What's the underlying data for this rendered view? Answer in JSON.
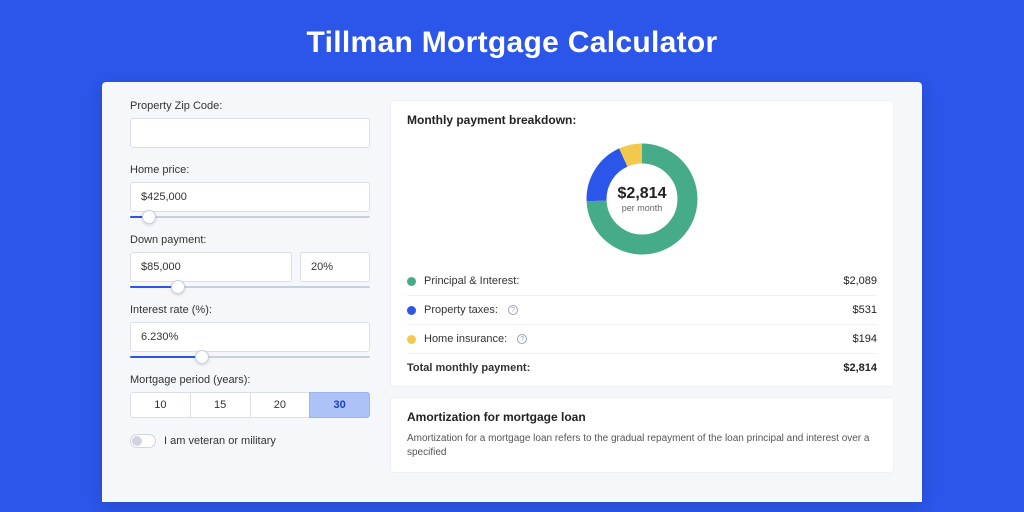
{
  "title": "Tillman Mortgage Calculator",
  "form": {
    "zip_label": "Property Zip Code:",
    "zip_value": "",
    "home_price_label": "Home price:",
    "home_price_value": "$425,000",
    "home_price_slider_pct": 8,
    "down_payment_label": "Down payment:",
    "down_payment_value": "$85,000",
    "down_payment_pct_value": "20%",
    "down_payment_slider_pct": 20,
    "interest_label": "Interest rate (%):",
    "interest_value": "6.230%",
    "interest_slider_pct": 30,
    "period_label": "Mortgage period (years):",
    "period_options": [
      "10",
      "15",
      "20",
      "30"
    ],
    "period_selected": "30",
    "veteran_label": "I am veteran or military"
  },
  "breakdown": {
    "title": "Monthly payment breakdown:",
    "total_value": "$2,814",
    "total_sub": "per month",
    "rows": [
      {
        "label": "Principal & Interest:",
        "value": "$2,089",
        "color": "#46ab89",
        "info": false,
        "key": "principal_interest"
      },
      {
        "label": "Property taxes:",
        "value": "$531",
        "color": "#2c56ea",
        "info": true,
        "key": "property_taxes"
      },
      {
        "label": "Home insurance:",
        "value": "$194",
        "color": "#f2c94c",
        "info": true,
        "key": "home_insurance"
      }
    ],
    "total_row_label": "Total monthly payment:",
    "total_row_value": "$2,814"
  },
  "chart_data": {
    "type": "pie",
    "title": "Monthly payment breakdown",
    "series": [
      {
        "name": "Principal & Interest",
        "value": 2089,
        "color": "#46ab89"
      },
      {
        "name": "Property taxes",
        "value": 531,
        "color": "#2c56ea"
      },
      {
        "name": "Home insurance",
        "value": 194,
        "color": "#f2c94c"
      }
    ],
    "total": 2814
  },
  "amortization": {
    "title": "Amortization for mortgage loan",
    "text": "Amortization for a mortgage loan refers to the gradual repayment of the loan principal and interest over a specified"
  },
  "colors": {
    "accent": "#2c56ea",
    "green": "#46ab89",
    "yellow": "#f2c94c"
  }
}
